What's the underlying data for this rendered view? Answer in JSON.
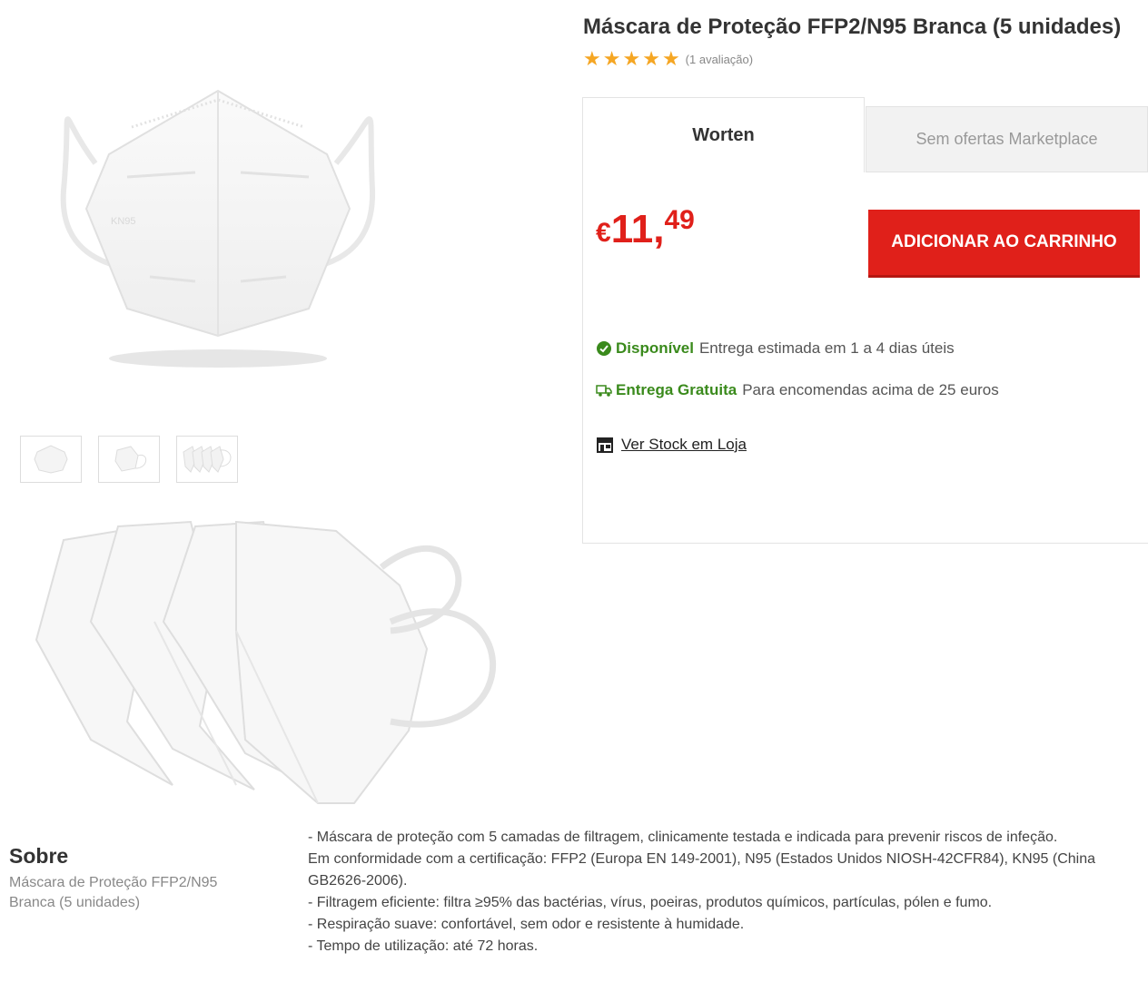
{
  "product": {
    "title": "Máscara de Proteção FFP2/N95 Branca (5 unidades)",
    "rating": {
      "stars": 5,
      "count_text": "(1 avaliação)"
    }
  },
  "gallery": {
    "main_image_mark": "KN95",
    "thumbnails": [
      "thumb-mask-front",
      "thumb-mask-side",
      "thumb-mask-stack"
    ]
  },
  "offers": {
    "tab_seller": "Worten",
    "tab_marketplace": "Sem ofertas Marketplace",
    "price": {
      "currency": "€",
      "integer": "11,",
      "decimal": "49"
    },
    "cart_button": "ADICIONAR AO CARRINHO",
    "availability": {
      "label": "Disponível",
      "text": "Entrega estimada em 1 a 4 dias úteis"
    },
    "delivery": {
      "label": "Entrega Gratuita",
      "text": "Para encomendas acima de 25 euros"
    },
    "stock_link": "Ver Stock em Loja"
  },
  "about": {
    "heading": "Sobre",
    "subtitle": "Máscara de Proteção FFP2/N95 Branca (5 unidades)",
    "lines": [
      "- Máscara de proteção com 5 camadas de filtragem, clinicamente testada e indicada para prevenir riscos de infeção.",
      "Em conformidade com a certificação: FFP2 (Europa EN 149-2001), N95 (Estados Unidos NIOSH-42CFR84), KN95 (China GB2626-2006).",
      "- Filtragem eficiente: filtra ≥95% das bactérias, vírus, poeiras, produtos químicos, partículas, pólen e fumo.",
      "- Respiração suave: confortável, sem odor e resistente à humidade.",
      "- Tempo de utilização: até 72 horas."
    ]
  },
  "colors": {
    "accent": "#e0201a",
    "available": "#3a8a1c",
    "star": "#f5a623"
  },
  "icons": [
    "star-icon",
    "check-circle-icon",
    "truck-icon",
    "store-icon"
  ]
}
